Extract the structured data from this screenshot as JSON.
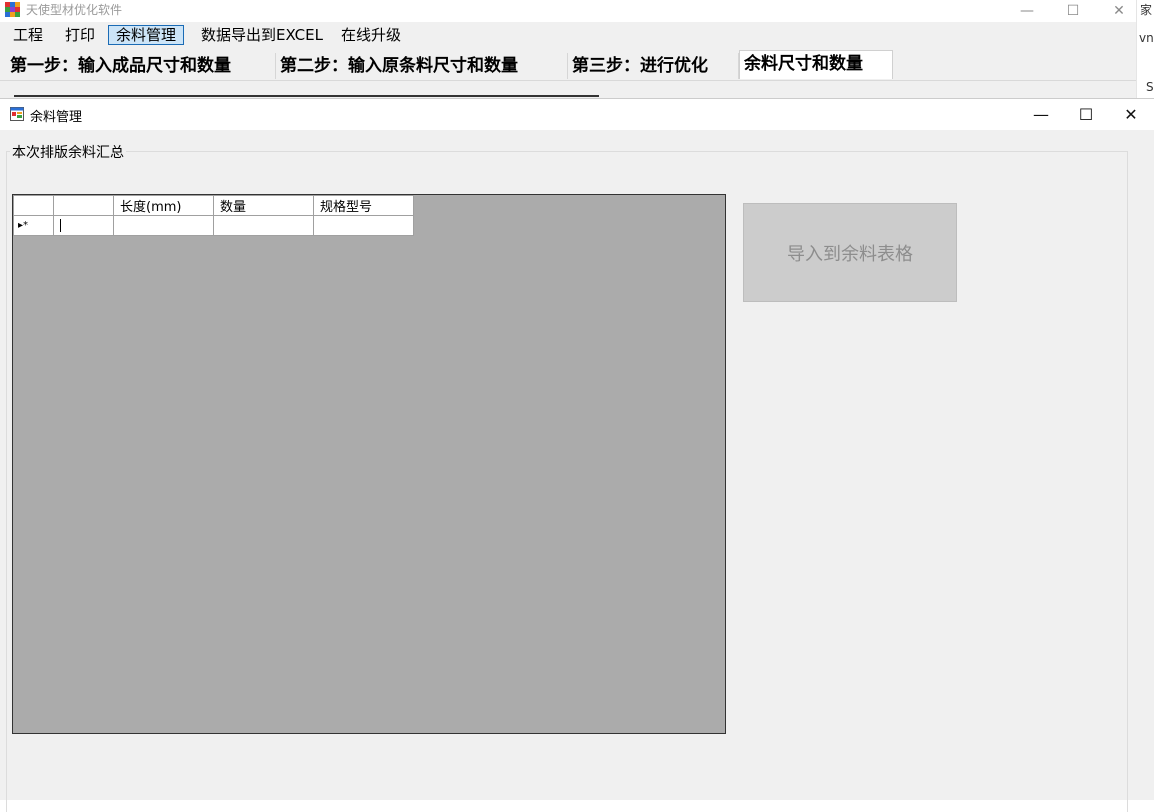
{
  "main_window": {
    "title": "天使型材优化软件",
    "controls": {
      "minimize": "—",
      "maximize": "☐",
      "close": "✕"
    },
    "menu": [
      {
        "label": "工程"
      },
      {
        "label": "打印"
      },
      {
        "label": "余料管理",
        "active": true
      },
      {
        "label": "数据导出到EXCEL"
      },
      {
        "label": "在线升级"
      }
    ],
    "tabs": [
      {
        "label": "第一步：输入成品尺寸和数量"
      },
      {
        "label": "第二步：输入原条料尺寸和数量"
      },
      {
        "label": "第三步：进行优化"
      },
      {
        "label": "余料尺寸和数量",
        "selected": true
      }
    ]
  },
  "edge_window": {
    "fragments": [
      "家",
      "vn",
      "S"
    ]
  },
  "dialog": {
    "title": "余料管理",
    "controls": {
      "minimize": "—",
      "maximize": "☐",
      "close": "✕"
    },
    "group_label": "本次排版余料汇总",
    "grid": {
      "columns": [
        "",
        "长度(mm)",
        "数量",
        "规格型号"
      ],
      "new_row_marker": "▸*"
    },
    "import_button": "导入到余料表格"
  },
  "colors": {
    "menu_active_bg": "#cce4f7",
    "menu_active_border": "#1a6bb5",
    "grid_background": "#ababab",
    "button_disabled_bg": "#cccccc",
    "button_disabled_text": "#8d8d8d"
  }
}
